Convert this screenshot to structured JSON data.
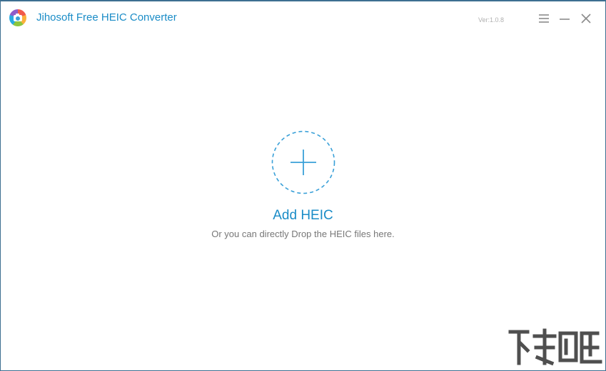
{
  "window": {
    "title": "Jihosoft Free HEIC Converter",
    "version": "Ver:1.0.8",
    "controls": {
      "menu_icon": "hamburger-menu-icon",
      "minimize_icon": "minimize-icon",
      "close_icon": "close-icon"
    }
  },
  "main": {
    "add_icon": "plus-icon",
    "add_label": "Add HEIC",
    "hint": "Or you can directly Drop the HEIC files here."
  },
  "colors": {
    "accent": "#1a8cc7",
    "dashed_circle": "#3aa0d8",
    "hint_text": "#777777",
    "border": "#3d6f91"
  }
}
